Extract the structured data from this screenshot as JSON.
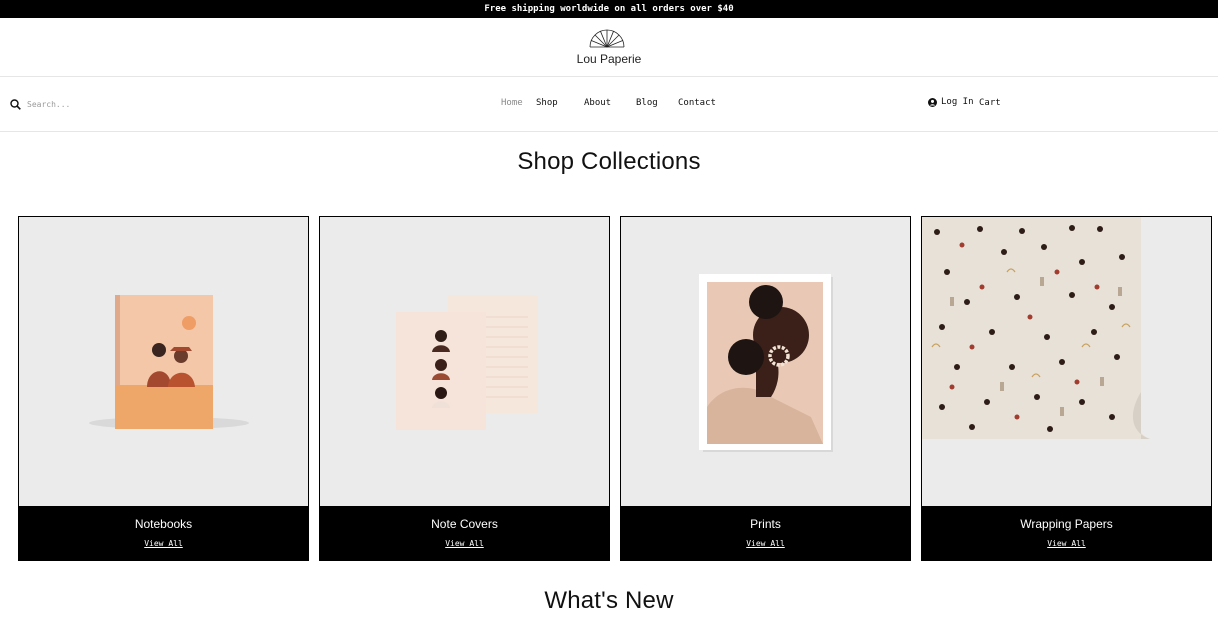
{
  "announcement": "Free shipping worldwide on all orders over $40",
  "brand": {
    "name": "Lou Paperie"
  },
  "search": {
    "placeholder": "Search..."
  },
  "nav": {
    "home": "Home",
    "shop": "Shop",
    "about": "About",
    "blog": "Blog",
    "contact": "Contact",
    "login": "Log In",
    "cart": "Cart"
  },
  "collections": {
    "heading": "Shop Collections",
    "items": [
      {
        "title": "Notebooks",
        "link": "View All"
      },
      {
        "title": "Note Covers",
        "link": "View All"
      },
      {
        "title": "Prints",
        "link": "View All"
      },
      {
        "title": "Wrapping Papers",
        "link": "View All"
      }
    ]
  },
  "whats_new": {
    "heading": "What's New"
  },
  "icons": {
    "search": "search-icon",
    "account": "user-circle-icon",
    "logo": "sunburst-logo-icon"
  }
}
